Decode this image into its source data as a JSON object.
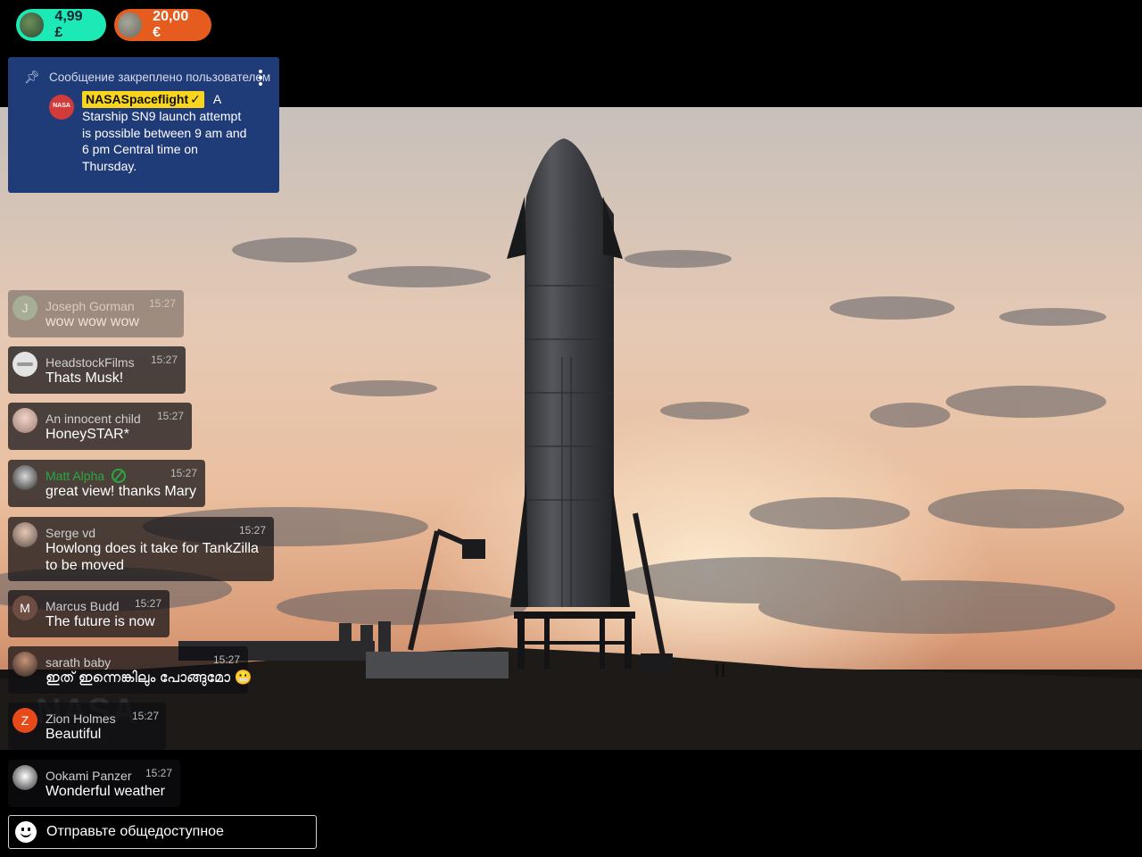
{
  "super_chats": [
    {
      "amount": "4,99 £",
      "color": "#1de9b6"
    },
    {
      "amount": "20,00 €",
      "color": "#e65c1f"
    }
  ],
  "pinned": {
    "header": "Сообщение закреплено пользователем",
    "icon": "pin-icon",
    "author": "NASASpaceflight",
    "author_badge": "verified-check",
    "avatar_text": "NASA",
    "text_first": "A",
    "text_rest": "Starship SN9 launch attempt is possible between 9 am and 6 pm Central time on Thursday."
  },
  "messages": [
    {
      "author": "Joseph Gorman",
      "time": "15:27",
      "text": "wow wow wow",
      "avatar_letter": "J"
    },
    {
      "author": "HeadstockFilms",
      "time": "15:27",
      "text": "Thats Musk!"
    },
    {
      "author": "An innocent child",
      "time": "15:27",
      "text": "HoneySTAR*"
    },
    {
      "author": "Matt Alpha",
      "time": "15:27",
      "text": "great view! thanks Mary"
    },
    {
      "author": "Serge vd",
      "time": "15:27",
      "text": "Howlong does it take for TankZilla",
      "text2": "to be moved"
    },
    {
      "author": "Marcus Budd",
      "time": "15:27",
      "text": "The future is now",
      "avatar_letter": "M"
    },
    {
      "author": "sarath baby",
      "time": "15:27",
      "text": "ഇത് ഇന്നെങ്കിലും പോങ്ങുമോ 😬"
    },
    {
      "author": "Zion Holmes",
      "time": "15:27",
      "text": "Beautiful",
      "avatar_letter": "Z"
    },
    {
      "author": "Ookami Panzer",
      "time": "15:27",
      "text": "Wonderful weather"
    }
  ],
  "input": {
    "placeholder": "Отправьте общедоступное",
    "icon": "emoji-icon"
  },
  "video": {
    "watermark": "NASA"
  }
}
